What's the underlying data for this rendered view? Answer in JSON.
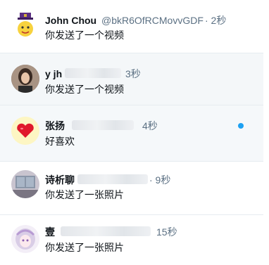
{
  "conversations": [
    {
      "name": "John Chou",
      "handle": "@bkR6OfRCMovvGDF",
      "time": "· 2秒",
      "preview": "你发送了一个视频"
    },
    {
      "name": "y jh",
      "time": "3秒",
      "preview": "你发送了一个视频"
    },
    {
      "name": "张扬",
      "time": "4秒",
      "preview": "好喜欢"
    },
    {
      "name": "诗析聊",
      "time": "· 9秒",
      "preview": "你发送了一张照片"
    },
    {
      "name": "壹",
      "time": "15秒",
      "preview": "你发送了一张照片"
    }
  ],
  "colors": {
    "accent": "#1da1f2",
    "muted": "#5b7083",
    "selected_bg": "#f4f7f9"
  },
  "icons": [
    "profile-avatar",
    "heart-emoji-avatar"
  ]
}
